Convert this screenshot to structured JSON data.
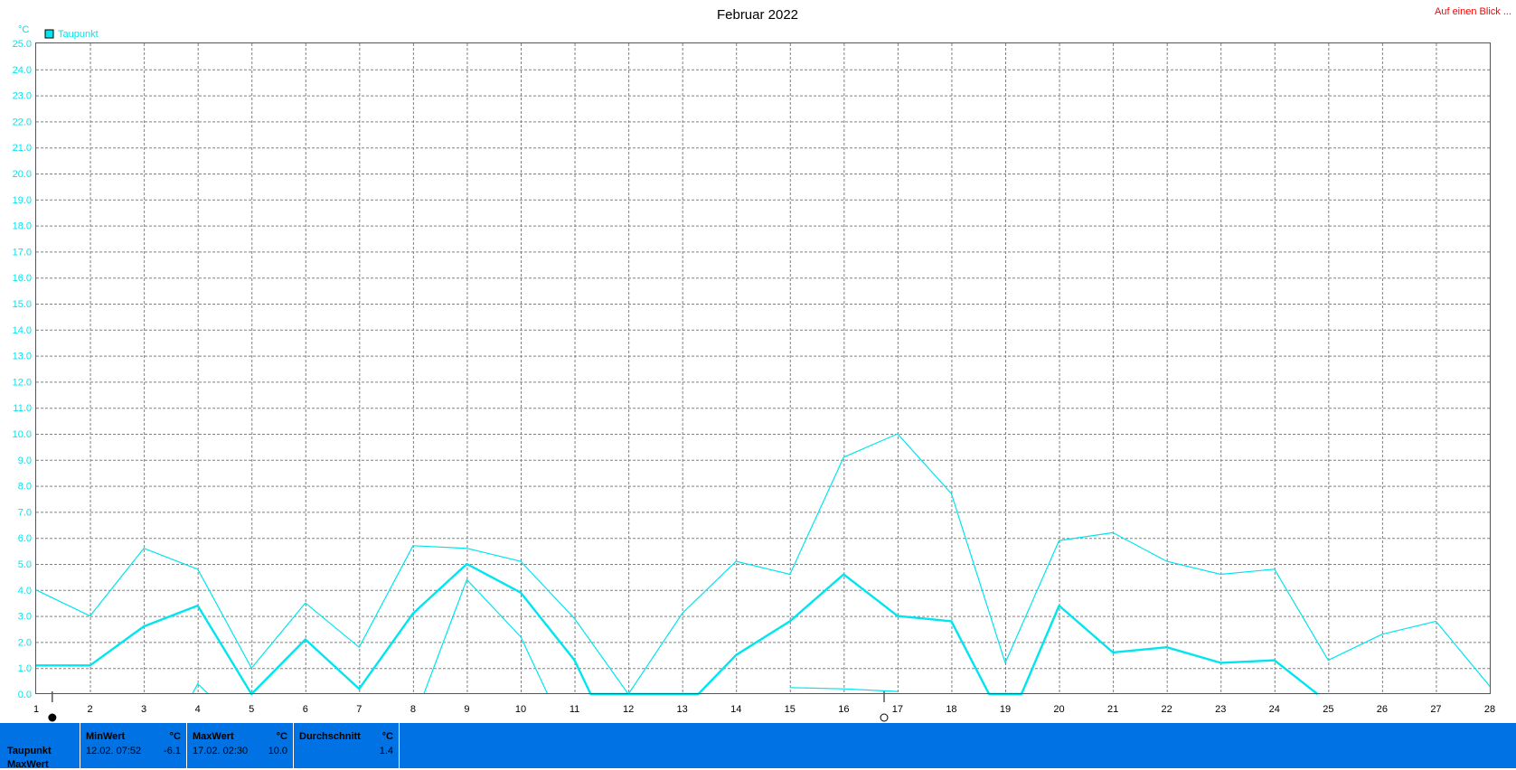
{
  "header": {
    "title": "Februar 2022",
    "top_link": "Auf einen Blick ..."
  },
  "colors": {
    "series": "#00e5ee",
    "panel": "#0072e3",
    "link": "#ff0000"
  },
  "chart_data": {
    "type": "line",
    "title": "Februar 2022",
    "ylabel": "°C",
    "ylim": [
      0,
      25
    ],
    "y_ticks": [
      "0.0",
      "1.0",
      "2.0",
      "3.0",
      "4.0",
      "5.0",
      "6.0",
      "7.0",
      "8.0",
      "9.0",
      "10.0",
      "11.0",
      "12.0",
      "13.0",
      "14.0",
      "15.0",
      "16.0",
      "17.0",
      "18.0",
      "19.0",
      "20.0",
      "21.0",
      "22.0",
      "23.0",
      "24.0",
      "25.0"
    ],
    "x": [
      1,
      2,
      3,
      4,
      5,
      6,
      7,
      8,
      9,
      10,
      11,
      12,
      13,
      14,
      15,
      16,
      17,
      18,
      19,
      20,
      21,
      22,
      23,
      24,
      25,
      26,
      27,
      28
    ],
    "xlim": [
      1,
      28
    ],
    "grid": true,
    "legend": {
      "label": "Taupunkt",
      "placement": "top-left"
    },
    "series": [
      {
        "name": "Taupunkt",
        "role": "max",
        "points": [
          [
            1,
            4.0
          ],
          [
            2,
            3.0
          ],
          [
            3,
            5.6
          ],
          [
            4,
            4.8
          ],
          [
            5,
            1.0
          ],
          [
            6,
            3.5
          ],
          [
            7,
            1.8
          ],
          [
            8,
            5.7
          ],
          [
            9,
            5.6
          ],
          [
            10,
            5.1
          ],
          [
            11,
            2.9
          ],
          [
            12,
            0.0
          ],
          [
            13,
            3.1
          ],
          [
            14,
            5.1
          ],
          [
            15,
            4.6
          ],
          [
            16,
            9.1
          ],
          [
            17,
            10.0
          ],
          [
            18,
            7.7
          ],
          [
            19,
            1.2
          ],
          [
            20,
            5.9
          ],
          [
            21,
            6.2
          ],
          [
            22,
            5.1
          ],
          [
            23,
            4.6
          ],
          [
            24,
            4.8
          ],
          [
            25,
            1.3
          ],
          [
            26,
            2.3
          ],
          [
            27,
            2.8
          ],
          [
            28,
            0.3
          ]
        ]
      },
      {
        "name": "Taupunkt",
        "role": "avg",
        "points": [
          [
            1,
            1.1
          ],
          [
            2,
            1.1
          ],
          [
            3,
            2.6
          ],
          [
            4,
            3.4
          ],
          [
            5,
            0.0
          ],
          [
            6,
            2.1
          ],
          [
            7,
            0.2
          ],
          [
            8,
            3.1
          ],
          [
            9,
            5.0
          ],
          [
            10,
            3.9
          ],
          [
            11,
            1.3
          ],
          [
            11.3,
            0.0
          ],
          [
            13.3,
            0.0
          ],
          [
            14,
            1.5
          ],
          [
            15,
            2.8
          ],
          [
            16,
            4.6
          ],
          [
            17,
            3.0
          ],
          [
            18,
            2.8
          ],
          [
            18.7,
            0.0
          ],
          [
            19.3,
            0.0
          ],
          [
            20,
            3.4
          ],
          [
            21,
            1.6
          ],
          [
            22,
            1.8
          ],
          [
            23,
            1.2
          ],
          [
            24,
            1.3
          ],
          [
            24.8,
            0.0
          ]
        ]
      },
      {
        "name": "Taupunkt",
        "role": "min",
        "segments": [
          [
            [
              3.9,
              0.0
            ],
            [
              4.0,
              0.4
            ],
            [
              4.2,
              0.0
            ]
          ],
          [
            [
              8.2,
              0.0
            ],
            [
              9.0,
              4.4
            ],
            [
              10.0,
              2.2
            ],
            [
              10.5,
              0.0
            ]
          ],
          [
            [
              15.0,
              0.25
            ],
            [
              16.0,
              0.2
            ],
            [
              17.0,
              0.1
            ]
          ]
        ]
      }
    ],
    "markers": [
      {
        "kind": "filled-circle",
        "x": 1.3
      },
      {
        "kind": "open-circle",
        "x": 16.75
      }
    ]
  },
  "stats": {
    "row_label": "Taupunkt",
    "row_label2": "MaxWert",
    "min": {
      "label": "MinWert",
      "unit": "°C",
      "time": "12.02.  07:52",
      "value": "-6.1"
    },
    "max": {
      "label": "MaxWert",
      "unit": "°C",
      "time": "17.02.  02:30",
      "value": "10.0"
    },
    "avg": {
      "label": "Durchschnitt",
      "unit": "°C",
      "value": "1.4"
    }
  }
}
